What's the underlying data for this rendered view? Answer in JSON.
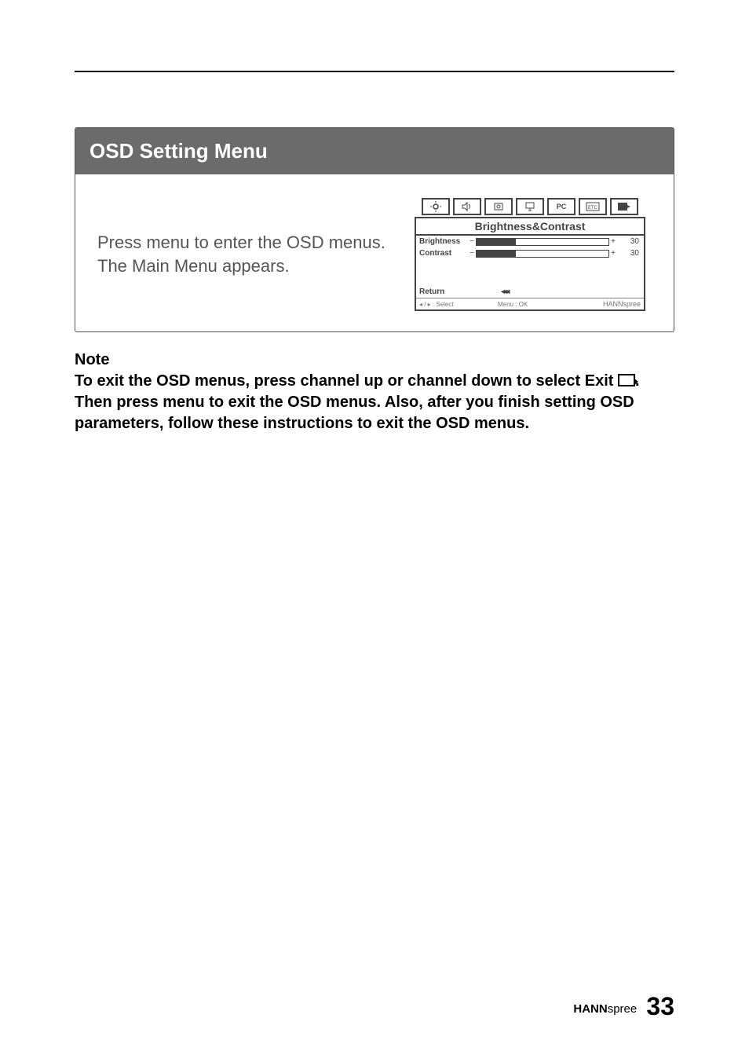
{
  "panel": {
    "title": "OSD Setting Menu",
    "instruction": "Press menu to enter the OSD menus. The Main Menu appears."
  },
  "osd": {
    "icons": [
      "brightness",
      "audio",
      "gear",
      "screen",
      "PC",
      "etc",
      "exit"
    ],
    "tab_title": "Brightness&Contrast",
    "rows": [
      {
        "label": "Brightness",
        "value": "30"
      },
      {
        "label": "Contrast",
        "value": "30"
      }
    ],
    "return_label": "Return",
    "footer_select": "◂ / ▸  :  Select",
    "footer_ok": "Menu  :  OK",
    "footer_brand": "HANNspree"
  },
  "note": {
    "heading": "Note",
    "line1": "To exit the OSD menus, press channel up or channel down to select Exit ",
    "line2": ". Then press menu to exit the OSD menus. Also, after you finish setting OSD parameters, follow these instructions to exit the OSD menus."
  },
  "footer": {
    "brand_bold": "HANN",
    "brand_light": "spree",
    "page_number": "33"
  },
  "chart_data": {
    "type": "bar",
    "title": "Brightness&Contrast",
    "categories": [
      "Brightness",
      "Contrast"
    ],
    "values": [
      30,
      30
    ],
    "ylim": [
      0,
      100
    ],
    "xlabel": "",
    "ylabel": ""
  }
}
